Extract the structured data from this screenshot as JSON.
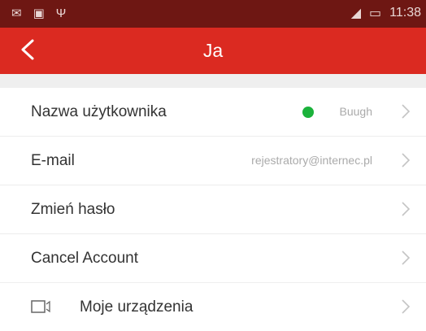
{
  "status_bar": {
    "time": "11:38",
    "icons": [
      "mail-icon",
      "image-icon",
      "usb-icon",
      "signal-icon",
      "battery-icon"
    ]
  },
  "header": {
    "title": "Ja"
  },
  "account": {
    "username_label": "Nazwa użytkownika",
    "username_value": "Buugh",
    "email_label": "E-mail",
    "email_value": "rejestratory@internec.pl",
    "change_password_label": "Zmień hasło",
    "cancel_account_label": "Cancel Account"
  },
  "devices": {
    "label": "Moje urządzenia"
  },
  "colors": {
    "accent": "#db2a21",
    "status_bar": "#6e1713",
    "online_dot": "#1bb23b"
  }
}
